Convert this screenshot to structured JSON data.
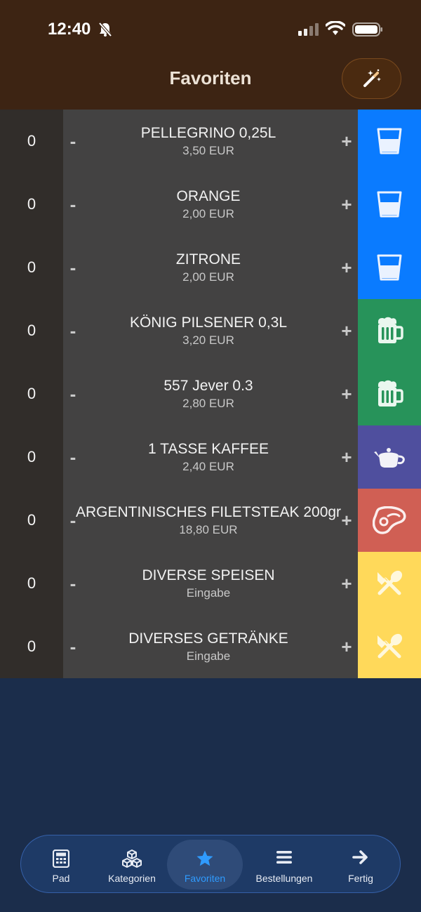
{
  "status_bar": {
    "time": "12:40"
  },
  "header": {
    "title": "Favoriten",
    "magic_icon": "magic-wand-icon"
  },
  "colors": {
    "blue": "#0a7bff",
    "green": "#27935a",
    "purple": "#4f4f9e",
    "red": "#d05f54",
    "yellow": "#ffd95a",
    "accent": "#2f9bff"
  },
  "items": [
    {
      "qty": "0",
      "name": "PELLEGRINO 0,25L",
      "price": "3,50 EUR",
      "icon": "glass-icon",
      "color": "#0a7bff"
    },
    {
      "qty": "0",
      "name": "ORANGE",
      "price": "2,00 EUR",
      "icon": "glass-icon",
      "color": "#0a7bff"
    },
    {
      "qty": "0",
      "name": "ZITRONE",
      "price": "2,00 EUR",
      "icon": "glass-icon",
      "color": "#0a7bff"
    },
    {
      "qty": "0",
      "name": "KÖNIG PILSENER 0,3L",
      "price": "3,20 EUR",
      "icon": "beer-mug-icon",
      "color": "#27935a"
    },
    {
      "qty": "0",
      "name": "557 Jever 0.3",
      "price": "2,80 EUR",
      "icon": "beer-mug-icon",
      "color": "#27935a"
    },
    {
      "qty": "0",
      "name": "1 TASSE KAFFEE",
      "price": "2,40 EUR",
      "icon": "teapot-icon",
      "color": "#4f4f9e"
    },
    {
      "qty": "0",
      "name": "ARGENTINISCHES FILETSTEAK 200gr",
      "price": "18,80 EUR",
      "icon": "steak-icon",
      "color": "#d05f54"
    },
    {
      "qty": "0",
      "name": "DIVERSE SPEISEN",
      "price": "Eingabe",
      "icon": "utensils-icon",
      "color": "#ffd95a"
    },
    {
      "qty": "0",
      "name": "DIVERSES GETRÄNKE",
      "price": "Eingabe",
      "icon": "utensils-icon",
      "color": "#ffd95a"
    }
  ],
  "row_controls": {
    "minus": "-",
    "plus": "+"
  },
  "tabs": [
    {
      "label": "Pad",
      "icon": "calculator-icon"
    },
    {
      "label": "Kategorien",
      "icon": "cubes-icon"
    },
    {
      "label": "Favoriten",
      "icon": "star-icon",
      "active": true
    },
    {
      "label": "Bestellungen",
      "icon": "list-icon"
    },
    {
      "label": "Fertig",
      "icon": "arrow-right-icon"
    }
  ]
}
